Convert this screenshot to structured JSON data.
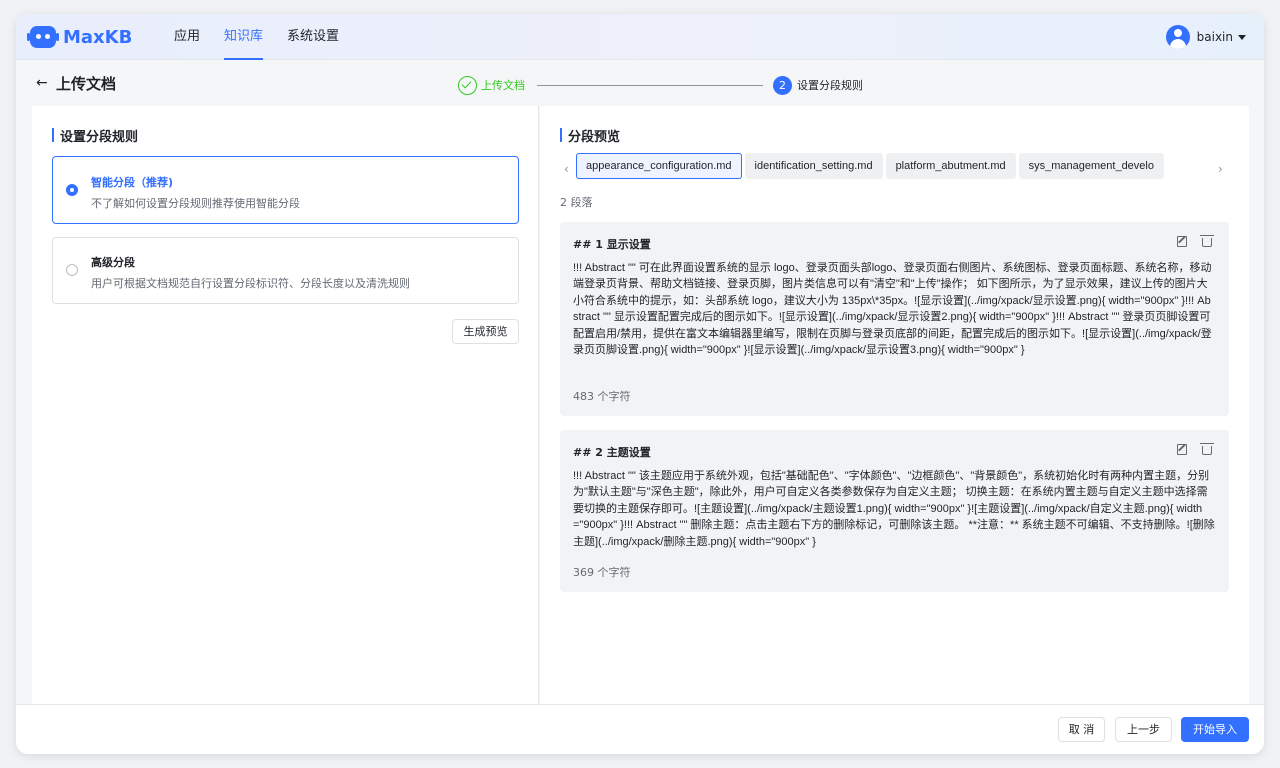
{
  "app": {
    "logo_text": "MaxKB"
  },
  "nav": {
    "items": [
      "应用",
      "知识库",
      "系统设置"
    ],
    "active_index": 1
  },
  "user": {
    "name": "baixin"
  },
  "page": {
    "title": "上传文档"
  },
  "steps": {
    "step1_label": "上传文档",
    "step2_number": "2",
    "step2_label": "设置分段规则"
  },
  "left": {
    "title": "设置分段规则",
    "options": [
      {
        "title": "智能分段（推荐)",
        "desc": "不了解如何设置分段规则推荐使用智能分段",
        "selected": true
      },
      {
        "title": "高级分段",
        "desc": "用户可根据文档规范自行设置分段标识符、分段长度以及清洗规则",
        "selected": false
      }
    ],
    "preview_button": "生成预览"
  },
  "right": {
    "title": "分段预览",
    "tab_prev": "‹",
    "tab_next": "›",
    "tabs": [
      "appearance_configuration.md",
      "identification_setting.md",
      "platform_abutment.md",
      "sys_management_develo"
    ],
    "active_tab": 0,
    "count_text": "2 段落",
    "segments": [
      {
        "title": "## 1 显示设置",
        "body": "!!! Abstract \"\" 可在此界面设置系统的显示 logo、登录页面头部logo、登录页面右侧图片、系统图标、登录页面标题、系统名称，移动端登录页背景、帮助文档链接、登录页脚，图片类信息可以有\"清空\"和\"上传\"操作； 如下图所示，为了显示效果，建议上传的图片大小符合系统中的提示，如：头部系统 logo，建议大小为 135px\\*35px。![显示设置](../img/xpack/显示设置.png){ width=\"900px\" }!!! Abstract \"\" 显示设置配置完成后的图示如下。![显示设置](../img/xpack/显示设置2.png){ width=\"900px\" }!!! Abstract \"\" 登录页页脚设置可配置启用/禁用，提供在富文本编辑器里编写，限制在页脚与登录页底部的间距，配置完成后的图示如下。![显示设置](../img/xpack/登录页页脚设置.png){ width=\"900px\" }![显示设置](../img/xpack/显示设置3.png){ width=\"900px\" }",
        "chars": "483 个字符"
      },
      {
        "title": "## 2 主题设置",
        "body": "!!! Abstract \"\" 该主题应用于系统外观，包括\"基础配色\"、\"字体颜色\"、\"边框颜色\"、\"背景颜色\"，系统初始化时有两种内置主题，分别为\"默认主题\"与\"深色主题\"，除此外，用户可自定义各类参数保存为自定义主题； 切换主题：在系统内置主题与自定义主题中选择需要切换的主题保存即可。![主题设置](../img/xpack/主题设置1.png){ width=\"900px\" }![主题设置](../img/xpack/自定义主题.png){ width=\"900px\" }!!! Abstract \"\" 删除主题：点击主题右下方的删除标记，可删除该主题。 **注意：** 系统主题不可编辑、不支持删除。![删除主题](../img/xpack/删除主题.png){ width=\"900px\" }",
        "chars": "369 个字符"
      }
    ]
  },
  "footer": {
    "cancel": "取 消",
    "prev": "上一步",
    "start": "开始导入"
  },
  "colors": {
    "accent": "#3370ff",
    "success": "#34c724"
  }
}
